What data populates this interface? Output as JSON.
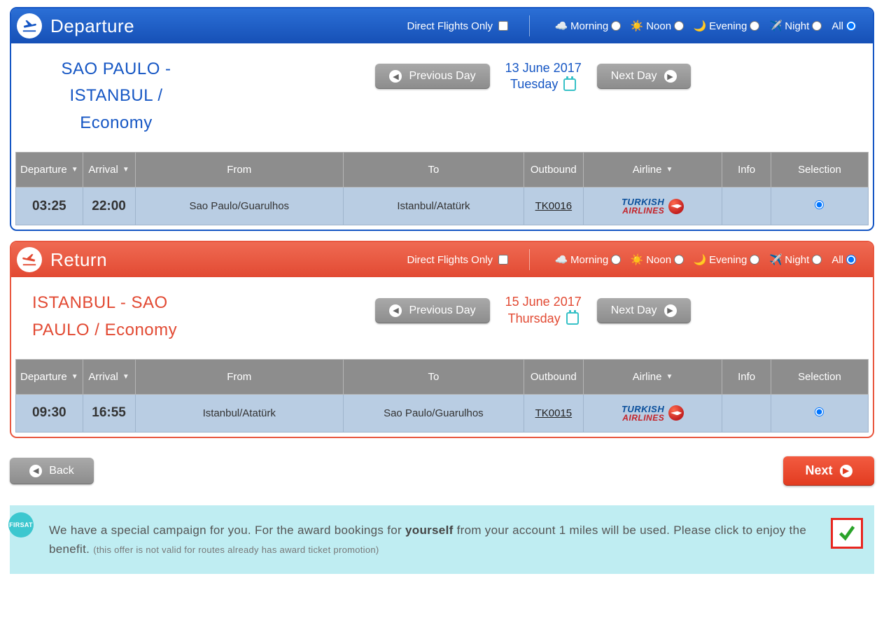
{
  "filters": {
    "direct_label": "Direct Flights Only",
    "times": [
      "Morning",
      "Noon",
      "Evening",
      "Night",
      "All"
    ]
  },
  "columns": {
    "departure": "Departure",
    "arrival": "Arrival",
    "from": "From",
    "to": "To",
    "outbound": "Outbound",
    "airline": "Airline",
    "info": "Info",
    "selection": "Selection"
  },
  "nav": {
    "prev": "Previous Day",
    "next": "Next Day",
    "back": "Back",
    "next_btn": "Next"
  },
  "departure": {
    "title": "Departure",
    "route_1": "SAO PAULO -",
    "route_2": "ISTANBUL /",
    "route_3": "Economy",
    "date": "13 June 2017",
    "dow": "Tuesday",
    "row": {
      "dep": "03:25",
      "arr": "22:00",
      "from": "Sao Paulo/Guarulhos",
      "to": "Istanbul/Atatürk",
      "outbound": "TK0016",
      "airline_1": "TURKISH",
      "airline_2": "AIRLINES"
    }
  },
  "return": {
    "title": "Return",
    "route_1": "ISTANBUL - SAO",
    "route_2": "PAULO / Economy",
    "date": "15 June 2017",
    "dow": "Thursday",
    "row": {
      "dep": "09:30",
      "arr": "16:55",
      "from": "Istanbul/Atatürk",
      "to": "Sao Paulo/Guarulhos",
      "outbound": "TK0015",
      "airline_1": "TURKISH",
      "airline_2": "AIRLINES"
    }
  },
  "promo": {
    "badge": "FIRSAT",
    "p1a": "We have a special campaign for you. For the award bookings for ",
    "p1b": "yourself",
    "p1c": " from your account 1 miles will be used. Please click to enjoy the benefit. ",
    "fine": "(this offer is not valid for routes already has award ticket promotion)"
  }
}
